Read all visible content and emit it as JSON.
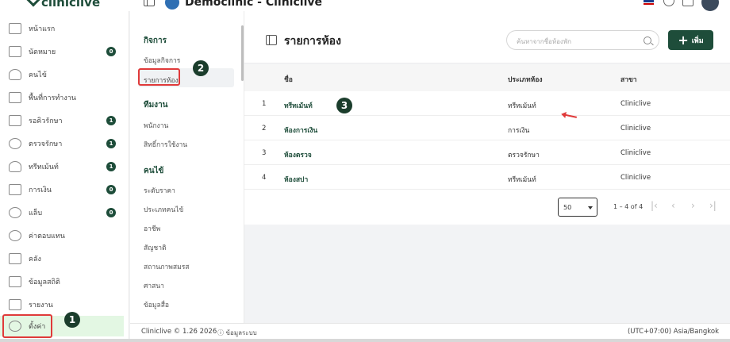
{
  "app": {
    "logo_text": "cliniclive",
    "clinic_title": "Democlinic - Cliniclive"
  },
  "sidebar": {
    "items": [
      {
        "label": "หน้าแรก",
        "icon": "home-icon"
      },
      {
        "label": "นัดหมาย",
        "icon": "calendar-icon",
        "badge": "0"
      },
      {
        "label": "คนไข้",
        "icon": "user-icon"
      },
      {
        "label": "พื้นที่การทำงาน",
        "icon": "workspace-icon"
      },
      {
        "label": "รอคิวรักษา",
        "icon": "car-icon",
        "badge": "1"
      },
      {
        "label": "ตรวจรักษา",
        "icon": "stethoscope-icon",
        "badge": "1"
      },
      {
        "label": "ทรีทเม้นท์",
        "icon": "doctor-icon",
        "badge": "1"
      },
      {
        "label": "การเงิน",
        "icon": "money-hand-icon",
        "badge": "0"
      },
      {
        "label": "แล็บ",
        "icon": "lab-tube-icon",
        "badge": "0"
      },
      {
        "label": "ค่าตอบแทน",
        "icon": "percent-icon"
      },
      {
        "label": "คลัง",
        "icon": "inventory-box-icon"
      },
      {
        "label": "ข้อมูลสถิติ",
        "icon": "stats-grid-icon"
      },
      {
        "label": "รายงาน",
        "icon": "report-chart-icon"
      },
      {
        "label": "ตั้งค่า",
        "icon": "gear-icon"
      }
    ]
  },
  "submenu": {
    "sections": [
      {
        "title": "กิจการ",
        "items": [
          "ข้อมูลกิจการ",
          "รายการห้อง"
        ]
      },
      {
        "title": "ทีมงาน",
        "items": [
          "พนักงาน",
          "สิทธิ์การใช้งาน"
        ]
      },
      {
        "title": "คนไข้",
        "items": [
          "ระดับราคา",
          "ประเภทคนไข้",
          "อาชีพ",
          "สัญชาติ",
          "สถานภาพสมรส",
          "ศาสนา",
          "ข้อมูลสื่อ"
        ]
      }
    ]
  },
  "main": {
    "title": "รายการห้อง",
    "search_placeholder": "ค้นหาจากชื่อห้องพัก",
    "add_label": "เพิ่ม",
    "columns": [
      "ชื่อ",
      "ประเภทห้อง",
      "สาขา"
    ],
    "rows": [
      {
        "no": "1",
        "name": "ทรีทเม้นท์",
        "type": "ทรีทเม้นท์",
        "branch": "Cliniclive"
      },
      {
        "no": "2",
        "name": "ห้องการเงิน",
        "type": "การเงิน",
        "branch": "Cliniclive"
      },
      {
        "no": "3",
        "name": "ห้องตรวจ",
        "type": "ตรวจรักษา",
        "branch": "Cliniclive"
      },
      {
        "no": "4",
        "name": "ห้องสปา",
        "type": "ทรีทเม้นท์",
        "branch": "Cliniclive"
      }
    ],
    "page_size": "50",
    "page_info": "1 – 4 of 4"
  },
  "annotations": {
    "step1": "1",
    "step2": "2",
    "step3": "3"
  },
  "footer": {
    "left": "Cliniclive © 1.26 2026",
    "info": "ⓘ ข้อมูลระบบ",
    "right": "(UTC+07:00) Asia/Bangkok"
  },
  "colors": {
    "brand": "#1e4d3a",
    "highlight": "#e03a3a",
    "active_bg": "#e3f7e3"
  }
}
